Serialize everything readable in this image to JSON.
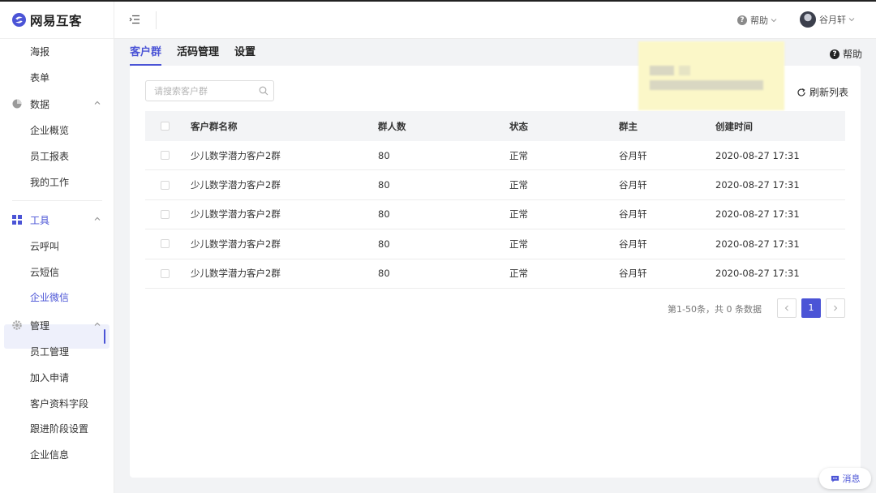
{
  "colors": {
    "accent": "#4b54d6",
    "page_bg": "#f2f3f5",
    "header_row_bg": "#f3f4f6"
  },
  "brand": {
    "name": "网易互客"
  },
  "sidebar": {
    "sub_top": [
      "海报",
      "表单"
    ],
    "data_group": {
      "label": "数据",
      "items": [
        "企业概览",
        "员工报表",
        "我的工作"
      ]
    },
    "tools_group": {
      "label": "工具",
      "items": [
        "云呼叫",
        "云短信",
        "企业微信"
      ]
    },
    "manage_group": {
      "label": "管理",
      "items": [
        "员工管理",
        "加入申请",
        "客户资料字段",
        "跟进阶段设置",
        "企业信息"
      ]
    }
  },
  "header": {
    "help_label": "帮助",
    "user_name": "谷月轩"
  },
  "tabs": [
    {
      "label": "客户群",
      "active": true
    },
    {
      "label": "活码管理",
      "active": false
    },
    {
      "label": "设置",
      "active": false
    }
  ],
  "help_right_label": "帮助",
  "search": {
    "placeholder": "请搜索客户群",
    "value": ""
  },
  "refresh_label": "刷新列表",
  "table": {
    "headers": [
      "客户群名称",
      "群人数",
      "状态",
      "群主",
      "创建时间"
    ],
    "rows": [
      [
        "少儿数学潜力客户2群",
        "80",
        "正常",
        "谷月轩",
        "2020-08-27 17:31"
      ],
      [
        "少儿数学潜力客户2群",
        "80",
        "正常",
        "谷月轩",
        "2020-08-27 17:31"
      ],
      [
        "少儿数学潜力客户2群",
        "80",
        "正常",
        "谷月轩",
        "2020-08-27 17:31"
      ],
      [
        "少儿数学潜力客户2群",
        "80",
        "正常",
        "谷月轩",
        "2020-08-27 17:31"
      ],
      [
        "少儿数学潜力客户2群",
        "80",
        "正常",
        "谷月轩",
        "2020-08-27 17:31"
      ]
    ]
  },
  "pagination": {
    "summary": "第1-50条，共 0 条数据",
    "current_page": "1"
  },
  "message_label": "消息"
}
